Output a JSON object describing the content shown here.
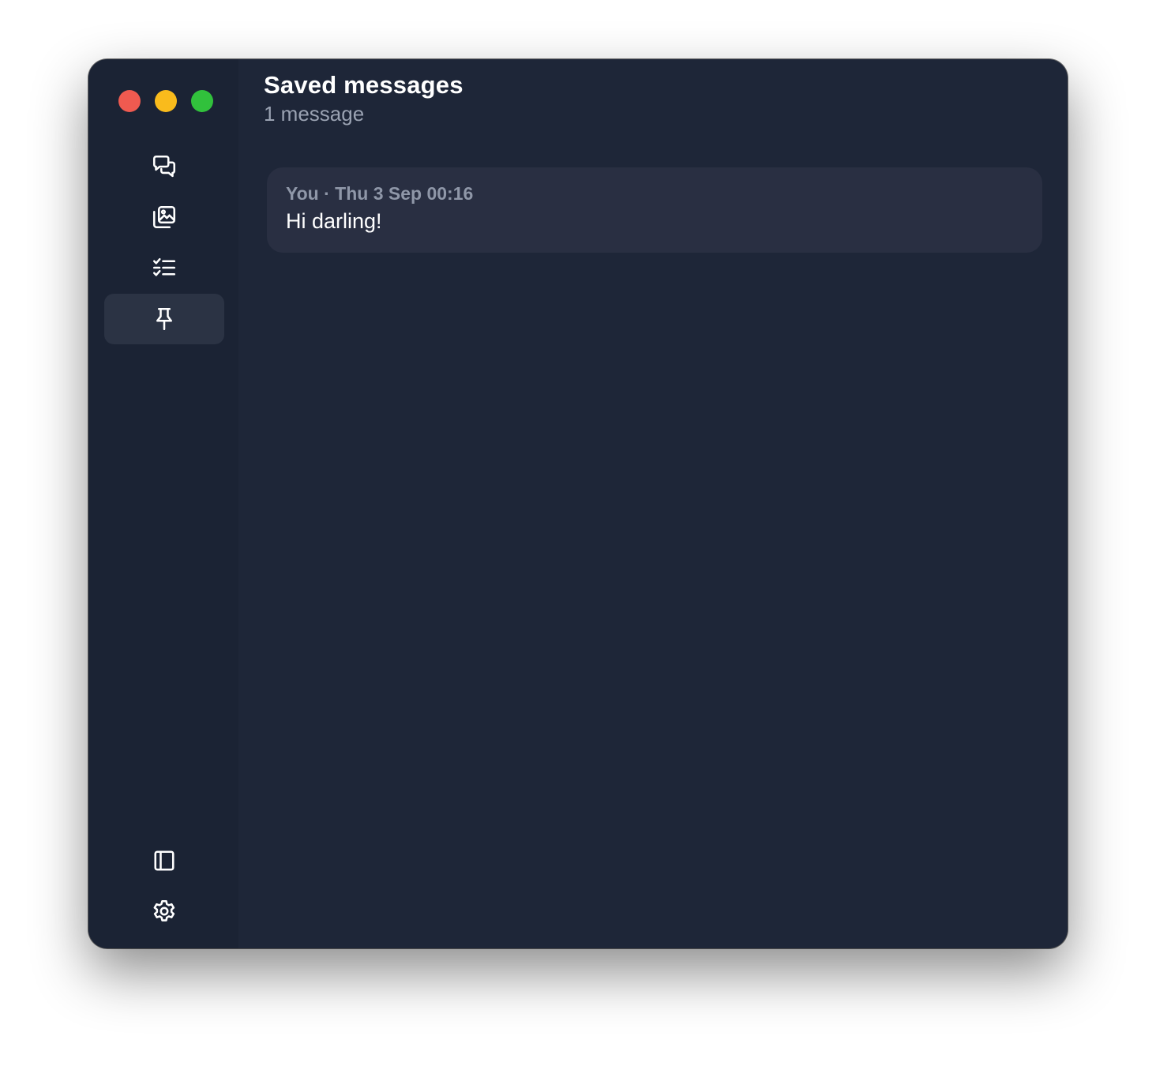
{
  "window": {
    "traffic_lights": [
      "close-button",
      "minimize-button",
      "zoom-button"
    ]
  },
  "sidebar": {
    "items": [
      {
        "icon": "chat-bubbles-icon",
        "active": false
      },
      {
        "icon": "images-icon",
        "active": false
      },
      {
        "icon": "checklist-icon",
        "active": false
      },
      {
        "icon": "pin-icon",
        "active": true
      }
    ],
    "bottom_items": [
      {
        "icon": "sidebar-toggle-icon"
      },
      {
        "icon": "gear-icon"
      }
    ]
  },
  "header": {
    "title": "Saved messages",
    "subtitle": "1 message"
  },
  "messages": [
    {
      "meta": "You · Thu 3 Sep 00:16",
      "text": "Hi darling!"
    }
  ],
  "colors": {
    "background": "#1e2638",
    "sidebar": "#1b2334",
    "card": "#292f42",
    "active_nav": "#2b3344",
    "close": "#ef5a50",
    "minimize": "#f9bb1c",
    "zoom": "#31c13c"
  }
}
